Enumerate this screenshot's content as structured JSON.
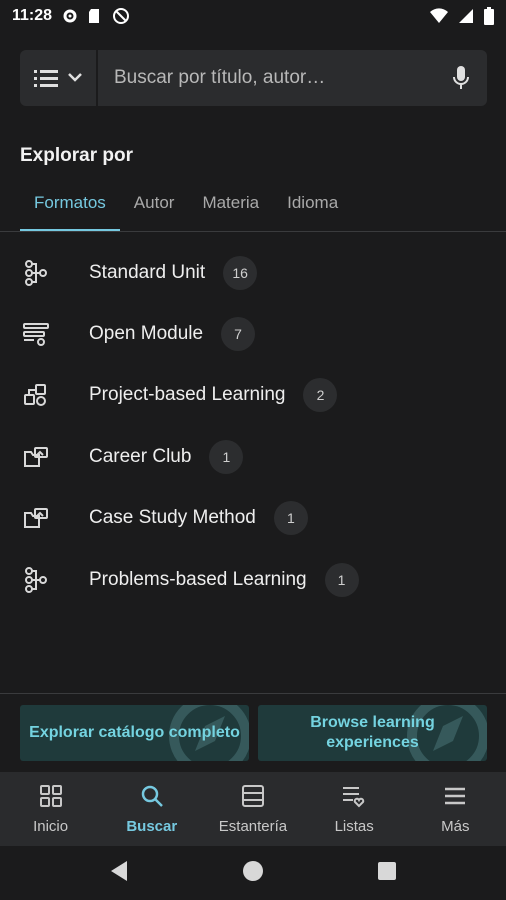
{
  "status": {
    "time": "11:28"
  },
  "search": {
    "placeholder": "Buscar por título, autor…"
  },
  "explore": {
    "title": "Explorar por",
    "tabs": [
      {
        "label": "Formatos",
        "active": true
      },
      {
        "label": "Autor"
      },
      {
        "label": "Materia"
      },
      {
        "label": "Idioma"
      }
    ]
  },
  "formats": [
    {
      "label": "Standard Unit",
      "count": "16",
      "icon": "network-icon"
    },
    {
      "label": "Open Module",
      "count": "7",
      "icon": "module-icon"
    },
    {
      "label": "Project-based Learning",
      "count": "2",
      "icon": "puzzle-icon"
    },
    {
      "label": "Career Club",
      "count": "1",
      "icon": "folder-image-icon"
    },
    {
      "label": "Case Study Method",
      "count": "1",
      "icon": "folder-image-icon"
    },
    {
      "label": "Problems-based Learning",
      "count": "1",
      "icon": "network-icon"
    }
  ],
  "cta": {
    "explore_catalog": "Explorar catálogo completo",
    "browse_learning": "Browse learning experiences"
  },
  "nav": [
    {
      "label": "Inicio",
      "icon": "grid-icon"
    },
    {
      "label": "Buscar",
      "icon": "search-icon",
      "active": true
    },
    {
      "label": "Estantería",
      "icon": "shelf-icon"
    },
    {
      "label": "Listas",
      "icon": "list-heart-icon"
    },
    {
      "label": "Más",
      "icon": "menu-icon"
    }
  ],
  "colors": {
    "accent": "#76c9e0",
    "background": "#1b1b1c",
    "surface": "#2b2c2e"
  }
}
